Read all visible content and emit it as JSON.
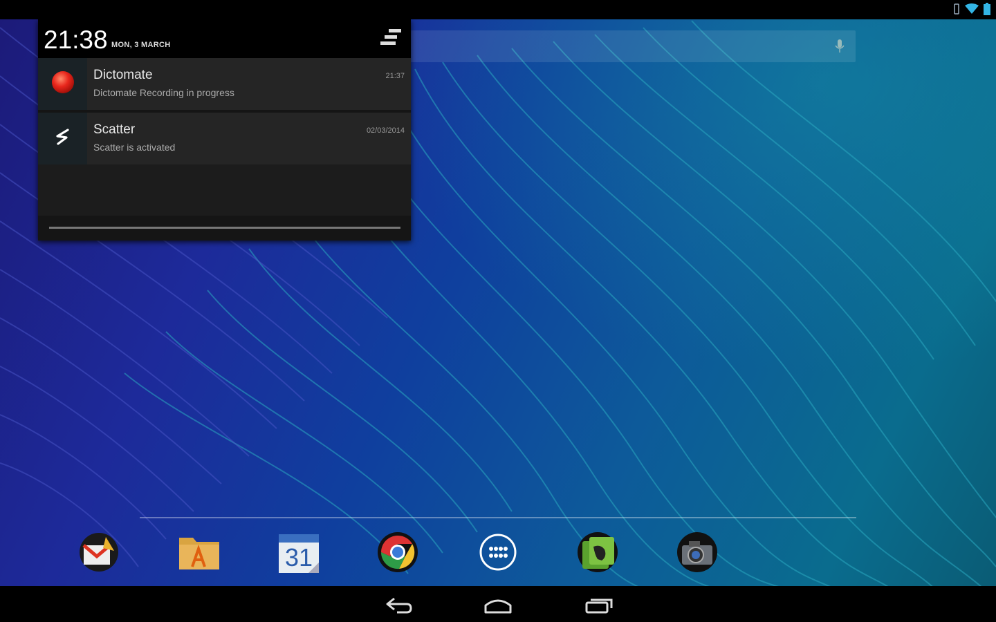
{
  "header": {
    "time": "21:38",
    "date": "MON, 3 MARCH"
  },
  "notifications": [
    {
      "app": "Dictomate",
      "text": "Dictomate Recording in progress",
      "time": "21:37",
      "icon": "record-icon"
    },
    {
      "app": "Scatter",
      "text": "Scatter is activated",
      "time": "02/03/2014",
      "icon": "scatter-icon"
    }
  ],
  "dock": [
    {
      "name": "gmail",
      "icon": "gmail-icon"
    },
    {
      "name": "file-manager",
      "icon": "folder-icon"
    },
    {
      "name": "calendar",
      "icon": "calendar-icon",
      "label": "31"
    },
    {
      "name": "chrome",
      "icon": "chrome-icon"
    },
    {
      "name": "app-drawer",
      "icon": "apps-grid-icon"
    },
    {
      "name": "evernote",
      "icon": "evernote-icon"
    },
    {
      "name": "camera",
      "icon": "camera-icon"
    }
  ],
  "navbar": [
    "back-icon",
    "home-icon",
    "recents-icon"
  ],
  "colors": {
    "panel_bg": "#151515",
    "notification_bg": "#252525",
    "record_red": "#e8261c"
  }
}
